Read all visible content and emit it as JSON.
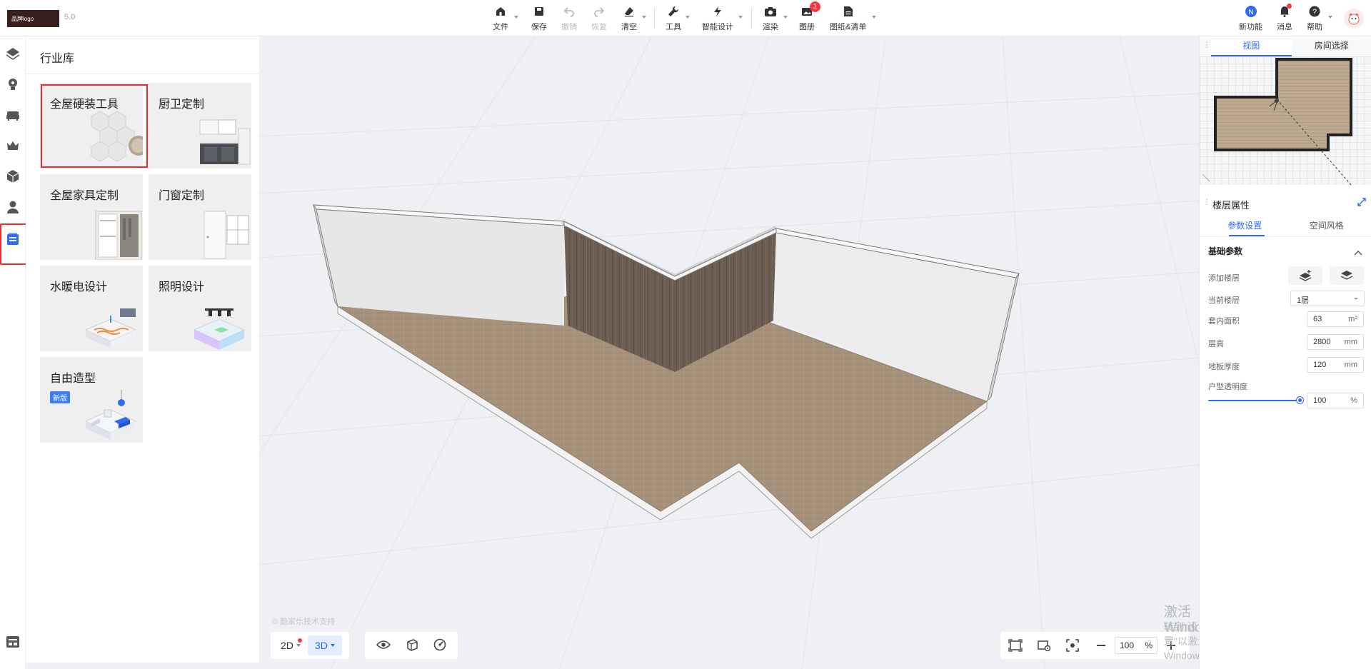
{
  "header": {
    "logo_text": "品牌logo",
    "version": "5.0",
    "toolbar": {
      "file": "文件",
      "save": "保存",
      "undo": "撤销",
      "redo": "恢复",
      "clear": "清空",
      "tools": "工具",
      "smart_design": "智能设计",
      "render": "渲染",
      "album": "图册",
      "album_badge": "1",
      "drawings": "图纸&清单"
    },
    "right": {
      "new_features": "新功能",
      "messages": "消息",
      "help": "帮助"
    }
  },
  "rail": {
    "items": [
      "layers-icon",
      "bulb-icon",
      "sofa-icon",
      "crown-icon",
      "model-icon",
      "user-icon",
      "library-icon",
      "bottom-panel-icon"
    ]
  },
  "library": {
    "title": "行业库",
    "cards": [
      {
        "label": "全屋硬装工具"
      },
      {
        "label": "厨卫定制"
      },
      {
        "label": "全屋家具定制"
      },
      {
        "label": "门窗定制"
      },
      {
        "label": "水暖电设计"
      },
      {
        "label": "照明设计"
      },
      {
        "label": "自由造型",
        "tag": "新版"
      }
    ]
  },
  "canvas": {
    "watermark": "© 酷家乐技术支持",
    "mode_2d": "2D",
    "mode_3d": "3D",
    "zoom_value": "100",
    "zoom_unit": "%",
    "windows_line1": "激活 Windows",
    "windows_line2": "转到\"设置\"以激活 Windows。"
  },
  "right_panel": {
    "tab_view": "视图",
    "tab_room_select": "房间选择",
    "section_title": "楼层属性",
    "subtab_params": "参数设置",
    "subtab_style": "空间风格",
    "group_title": "基础参数",
    "add_floor_label": "添加楼层",
    "current_floor_label": "当前楼层",
    "current_floor_value": "1层",
    "inner_area_label": "套内面积",
    "inner_area_value": "63",
    "inner_area_unit": "m²",
    "floor_height_label": "层高",
    "floor_height_value": "2800",
    "floor_height_unit": "mm",
    "slab_thickness_label": "地板厚度",
    "slab_thickness_value": "120",
    "slab_thickness_unit": "mm",
    "transparency_label": "户型透明度",
    "transparency_value": "100",
    "transparency_unit": "%",
    "transparency_level": 1.0
  },
  "colors": {
    "accent": "#2f6bf2",
    "highlight": "#e82e2e",
    "badge": "#f5393e",
    "floor": "#a89580",
    "wood_wall": "#6e5f55"
  }
}
